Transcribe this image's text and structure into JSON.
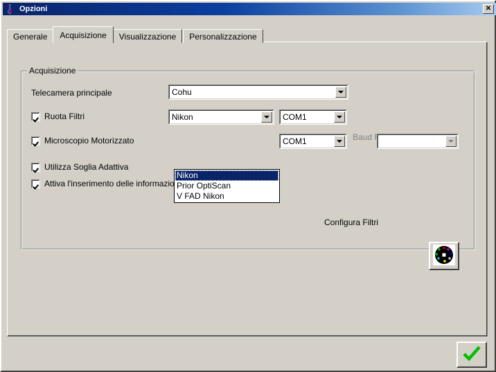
{
  "window": {
    "title": "Opzioni",
    "icon": "dna-helix-icon",
    "close_label": "✕",
    "background_color": "#d4d0c8",
    "titlebar_gradient_from": "#0a246a",
    "titlebar_gradient_to": "#a6caf0"
  },
  "tabs": [
    {
      "label": "Generale",
      "selected": false
    },
    {
      "label": "Acquisizione",
      "selected": true
    },
    {
      "label": "Visualizzazione",
      "selected": false
    },
    {
      "label": "Personalizzazione",
      "selected": false
    }
  ],
  "groupbox": {
    "title": "Acquisizione"
  },
  "fields": {
    "camera": {
      "label": "Telecamera principale",
      "value": "Cohu"
    },
    "filter_wheel": {
      "label": "Ruota Filtri",
      "checked": true,
      "device_value": "Nikon",
      "port_value": "COM1"
    },
    "motorized_microscope": {
      "label": "Microscopio Motorizzato",
      "checked": true,
      "port_value": "COM1",
      "baud_label": "Baud Rate",
      "baud_value": "",
      "baud_disabled": true
    },
    "adaptive_threshold": {
      "label": "Utilizza Soglia Adattiva",
      "checked": true
    },
    "single_cell_info": {
      "label": "Attiva l'inserimento delle informazioni su singola cellula",
      "checked": true
    }
  },
  "dropdown": {
    "open": true,
    "items": [
      "Nikon",
      "Prior OptiScan",
      "V FAD Nikon"
    ],
    "selected_index": 0,
    "highlight_color": "#0a246a"
  },
  "configure_filters": {
    "label": "Configura Filtri",
    "icon": "filter-wheel-icon"
  },
  "ok_button": {
    "icon": "green-checkmark-icon",
    "color": "#00c000"
  }
}
